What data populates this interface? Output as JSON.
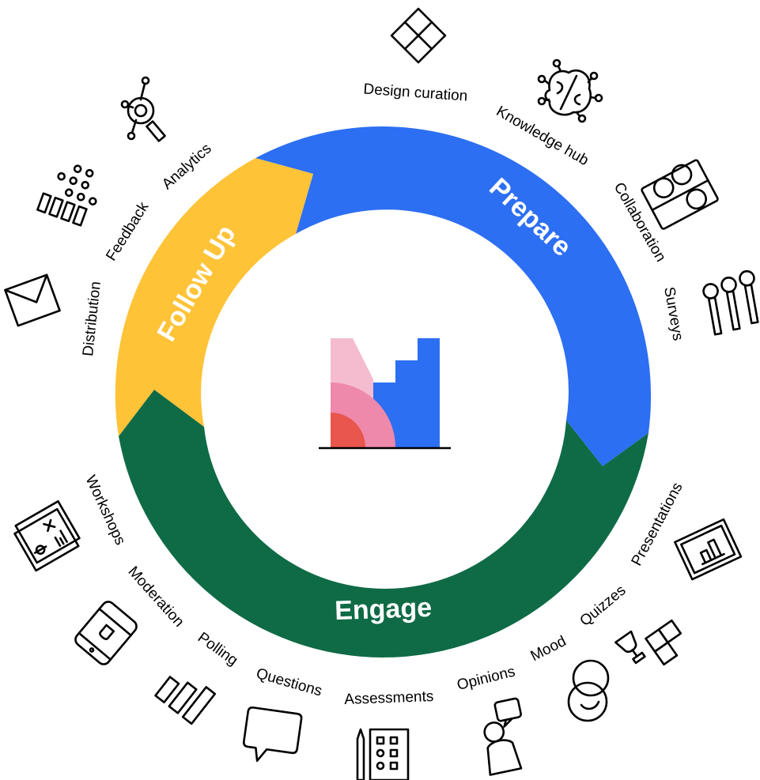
{
  "segments": [
    {
      "label": "Prepare",
      "color": "#2d6ff2"
    },
    {
      "label": "Engage",
      "color": "#0f6b45"
    },
    {
      "label": "Follow Up",
      "color": "#ffc338"
    }
  ],
  "outer_labels": [
    {
      "text": "Design curation",
      "icon": "grid-squares-icon"
    },
    {
      "text": "Knowledge hub",
      "icon": "brain-icon"
    },
    {
      "text": "Collaboration",
      "icon": "people-group-icon"
    },
    {
      "text": "Surveys",
      "icon": "pins-icon"
    },
    {
      "text": "Presentations",
      "icon": "presentation-board-icon"
    },
    {
      "text": "Quizzes",
      "icon": "trophy-puzzle-icon"
    },
    {
      "text": "Mood",
      "icon": "face-icon"
    },
    {
      "text": "Opinions",
      "icon": "person-speech-icon"
    },
    {
      "text": "Assessments",
      "icon": "checklist-pen-icon"
    },
    {
      "text": "Questions",
      "icon": "speech-bubble-icon"
    },
    {
      "text": "Polling",
      "icon": "bar-chart-icon"
    },
    {
      "text": "Moderation",
      "icon": "tablet-icon"
    },
    {
      "text": "Workshops",
      "icon": "whiteboard-icon"
    },
    {
      "text": "Distribution",
      "icon": "envelope-icon"
    },
    {
      "text": "Feedback",
      "icon": "dots-bars-icon"
    },
    {
      "text": "Analytics",
      "icon": "analytics-magnifier-icon"
    }
  ],
  "logo": {
    "colors": [
      "#f5bcd0",
      "#ef89ab",
      "#e9564d",
      "#2d6ff2"
    ]
  }
}
